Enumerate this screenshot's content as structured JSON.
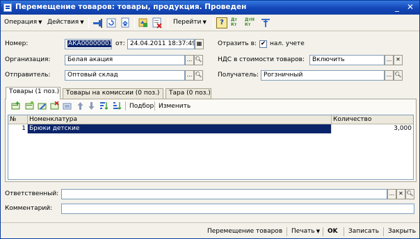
{
  "window": {
    "title": "Перемещение товаров: товары, продукция. Проведен",
    "minimize": "_",
    "close": "✕"
  },
  "toolbar": {
    "operation_menu": "Операция",
    "actions_menu": "Действия",
    "goto_menu": "Перейти",
    "help": "?",
    "dt_kt_1": "Дт Кт",
    "dt_kt_2": "ДтН Кт",
    "icons": [
      "pin-icon",
      "refresh-icon",
      "refresh-file-icon",
      "structure-icon",
      "cancel-icon",
      "help-icon",
      "dt-kt-icon",
      "dt-kt-n-icon",
      "filter-icon"
    ]
  },
  "header": {
    "number_label": "Номер:",
    "number_value": "АКА00000001",
    "date_label": "от:",
    "date_value": "24.04.2011 18:37:49",
    "reflect_label": "Отразить в:",
    "reflect_option": "нал. учете",
    "reflect_checked": true,
    "org_label": "Организация:",
    "org_value": "Белая акация",
    "vat_label": "НДС в стоимости товаров:",
    "vat_value": "Включить",
    "sender_label": "Отправитель:",
    "sender_value": "Оптовый склад",
    "receiver_label": "Получатель:",
    "receiver_value": "Рогзничный"
  },
  "tabs": [
    {
      "label": "Товары (1 поз.)",
      "active": true
    },
    {
      "label": "Товары на комиссии (0 поз.)",
      "active": false
    },
    {
      "label": "Тара (0 поз.)",
      "active": false
    }
  ],
  "table_toolbar": {
    "selection": "Подбор",
    "change": "Изменить",
    "icons": [
      "add-row-icon",
      "copy-row-icon",
      "edit-row-icon",
      "delete-row-icon",
      "end-edit-icon",
      "move-up-icon",
      "move-down-icon",
      "sort-asc-icon",
      "sort-desc-icon"
    ]
  },
  "table": {
    "columns": [
      "№",
      "Номенклатура",
      "Количество"
    ],
    "rows": [
      {
        "n": "1",
        "item": "Брюки детские",
        "qty": "3,000"
      }
    ]
  },
  "footer": {
    "responsible_label": "Ответственный:",
    "responsible_value": "",
    "comment_label": "Комментарий:",
    "comment_value": ""
  },
  "bottom": {
    "doc_button": "Перемещение товаров",
    "print_button": "Печать",
    "ok_button": "OK",
    "save_button": "Записать",
    "close_button": "Закрыть"
  },
  "colors": {
    "title_bar": "#1447b8",
    "selection": "#0a246a",
    "background": "#f3f1ea"
  }
}
